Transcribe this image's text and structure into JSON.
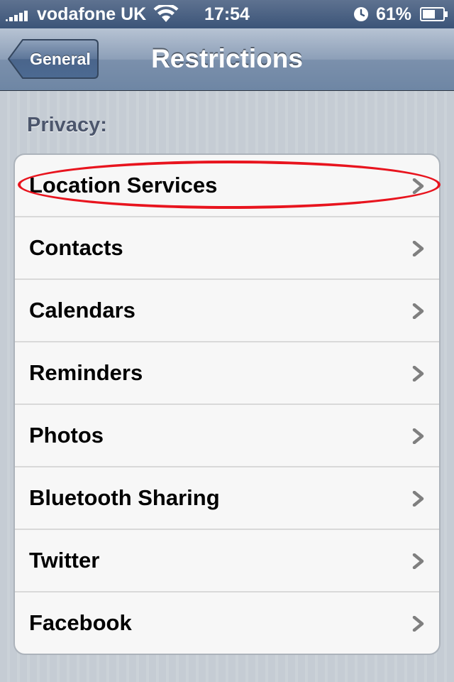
{
  "status_bar": {
    "carrier": "vodafone UK",
    "time": "17:54",
    "battery_percent": "61%",
    "signal_icon": "signal-bars-icon",
    "wifi_icon": "wifi-icon",
    "alarm_icon": "alarm-clock-icon",
    "battery_icon": "battery-icon"
  },
  "nav": {
    "back_label": "General",
    "title": "Restrictions"
  },
  "section": {
    "header": "Privacy:",
    "items": [
      {
        "label": "Location Services"
      },
      {
        "label": "Contacts"
      },
      {
        "label": "Calendars"
      },
      {
        "label": "Reminders"
      },
      {
        "label": "Photos"
      },
      {
        "label": "Bluetooth Sharing"
      },
      {
        "label": "Twitter"
      },
      {
        "label": "Facebook"
      }
    ]
  },
  "colors": {
    "highlight": "#e8141e",
    "nav_bar": "#7b90ac",
    "background": "#c5ccd4"
  }
}
